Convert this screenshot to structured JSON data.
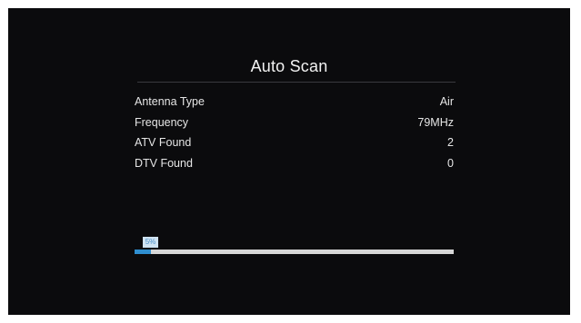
{
  "dialog": {
    "title": "Auto Scan"
  },
  "info": {
    "rows": [
      {
        "label": "Antenna Type",
        "value": "Air"
      },
      {
        "label": "Frequency",
        "value": "79MHz"
      },
      {
        "label": "ATV Found",
        "value": "2"
      },
      {
        "label": "DTV Found",
        "value": "0"
      }
    ]
  },
  "progress": {
    "label": "5%",
    "fraction": 0.05
  },
  "colors": {
    "background": "#0b0b0d",
    "text": "#e6e6e6",
    "progress_fill": "#2f8fd0",
    "progress_track": "#d7d7d7"
  }
}
